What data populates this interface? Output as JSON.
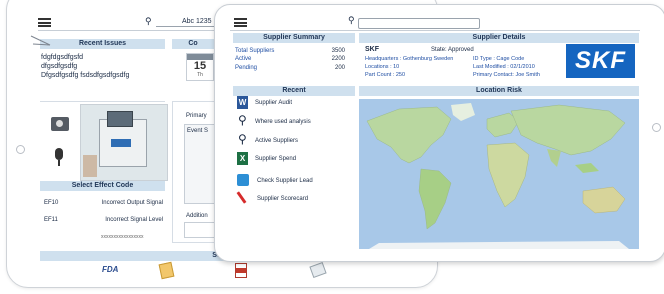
{
  "back_app": {
    "search_value": "Abc 1235",
    "recent_issues": {
      "title": "Recent Issues",
      "lines": [
        "fdgfdgsdfgsfd",
        "dfgsdfgsdfg",
        "Dfgsdfgsdfg fsdsdfgsdfgsdfg"
      ]
    },
    "calendar": {
      "title": "Co",
      "day": "15",
      "subday": "Th"
    },
    "primary_label": "Primary",
    "event_label": "Event S",
    "additional_label": "Addition",
    "select_effect_code": {
      "title": "Select Effect Code",
      "rows": [
        {
          "code": "EF10",
          "desc": "Incorrect Output Signal"
        },
        {
          "code": "EF11",
          "desc": "Incorrect Signal Level"
        }
      ],
      "footer": "xxxxxxxxxxxxxxxxx"
    },
    "status_label": "Status",
    "fda_label": "FDA"
  },
  "front_app": {
    "search_value": "",
    "supplier_summary": {
      "title": "Supplier Summary",
      "rows": [
        {
          "label": "Total Suppliers",
          "value": "3500"
        },
        {
          "label": "Active",
          "value": "2200"
        },
        {
          "label": "Pending",
          "value": "200"
        }
      ]
    },
    "supplier_details": {
      "title": "Supplier Details",
      "name": "SKF",
      "state": "State: Approved",
      "headquarters": "Headquarters : Gothenburg Sweden",
      "locations": "Locations : 10",
      "part_count": "Part Count : 250",
      "id_type": "ID Type : Cage Code",
      "last_modified": "Last Modified : 02/1/2010",
      "primary_contact": "Primary Contact: Joe Smith",
      "logo_text": "SKF"
    },
    "recent": {
      "title": "Recent",
      "items": [
        {
          "label": "Supplier Audit",
          "icon": "word-doc-icon"
        },
        {
          "label": "Where used analysis",
          "icon": "magnifier-icon"
        },
        {
          "label": "Active Suppliers",
          "icon": "magnifier-icon"
        },
        {
          "label": "Supplier Spend",
          "icon": "excel-doc-icon"
        },
        {
          "label": "Check Supplier Lead",
          "icon": "edit-icon"
        },
        {
          "label": "Supplier Scorecard",
          "icon": "pen-icon"
        }
      ]
    },
    "location_risk": {
      "title": "Location Risk"
    }
  },
  "colors": {
    "header_bg": "#cfe0ee",
    "accent_blue": "#1f4ea3",
    "skf_blue": "#1565c0",
    "map_water": "#a8c8e8",
    "map_land": "#b9d7a0"
  }
}
